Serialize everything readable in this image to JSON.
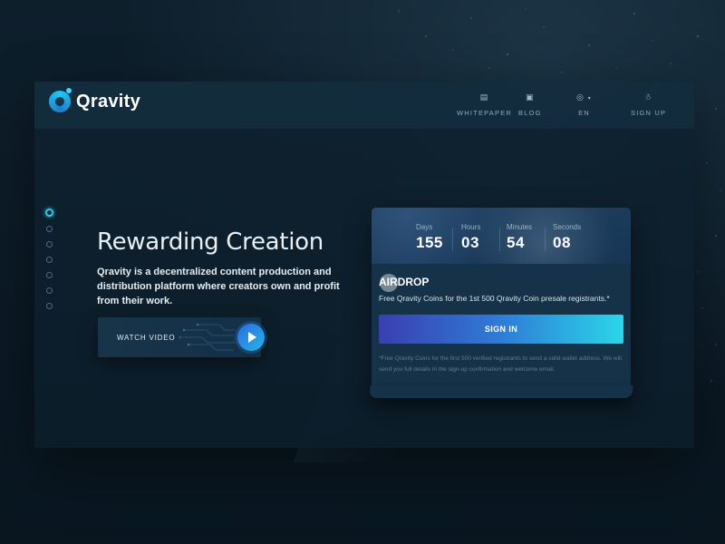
{
  "brand": {
    "name": "Qravity"
  },
  "nav": {
    "items": [
      {
        "label": "WHITEPAPER",
        "icon": "document-icon"
      },
      {
        "label": "BLOG",
        "icon": "newspaper-icon"
      },
      {
        "label": "EN",
        "icon": "globe-icon"
      },
      {
        "label": "SIGN UP",
        "icon": "user-add-icon"
      }
    ]
  },
  "hero": {
    "title": "Rewarding Creation",
    "description": "Qravity is a decentralized content production and distribution platform where creators own and profit from their work.",
    "watch_label": "WATCH VIDEO",
    "slides": 7,
    "active_slide": 1
  },
  "countdown": {
    "days_label": "Days",
    "days": "155",
    "hours_label": "Hours",
    "hours": "03",
    "minutes_label": "Minutes",
    "minutes": "54",
    "seconds_label": "Seconds",
    "seconds": "08"
  },
  "airdrop": {
    "title": "AIRDROP",
    "description": "Free Qravity Coins for the 1st 500 Qravity Coin presale registrants.*",
    "button": "SIGN IN",
    "note": "*Free Qravity Coins for the first 500 verified registrants to send a valid wallet address. We will send you full details in the sign-up confirmation and welcome email."
  },
  "colors": {
    "accent": "#2bc8ef",
    "background": "#0b1a25",
    "card": "#163248",
    "button_start": "#3a3fb0",
    "button_end": "#2ad6e8"
  }
}
